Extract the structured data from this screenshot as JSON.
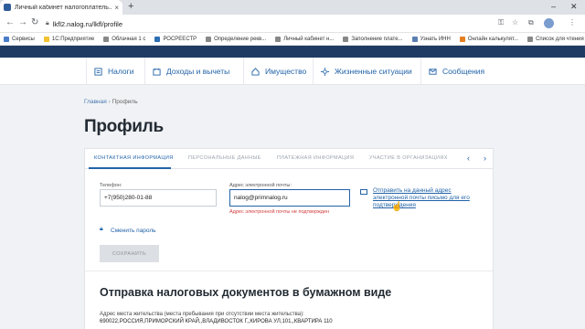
{
  "browser": {
    "tab_title": "Личный кабинет налогоплатель...",
    "tab_close": "×",
    "new_tab": "+",
    "minimize": "–",
    "close": "✕",
    "url": "lkfl2.nalog.ru/lkfl/profile",
    "bookmarks": [
      {
        "label": "Сервисы",
        "color": "#4a7dc9"
      },
      {
        "label": "1С:Предприятие",
        "color": "#f2c230"
      },
      {
        "label": "Облачная 1 с",
        "color": "#888888"
      },
      {
        "label": "РОСРЕЕСТР",
        "color": "#2d6db3"
      },
      {
        "label": "Определение рекв...",
        "color": "#888888"
      },
      {
        "label": "Личный кабинет н...",
        "color": "#888888"
      },
      {
        "label": "Заполнение плате...",
        "color": "#888888"
      },
      {
        "label": "Узнать ИНН",
        "color": "#5a7fb0"
      },
      {
        "label": "Онлайн калькулят...",
        "color": "#e67e22"
      },
      {
        "label": "Список для чтения",
        "color": "#888888"
      }
    ]
  },
  "nav": {
    "items": [
      {
        "label": "Налоги",
        "icon": "taxes-icon"
      },
      {
        "label": "Доходы и вычеты",
        "icon": "income-icon"
      },
      {
        "label": "Имущество",
        "icon": "property-icon"
      },
      {
        "label": "Жизненные ситуации",
        "icon": "life-situations-icon"
      },
      {
        "label": "Сообщения",
        "icon": "messages-icon"
      }
    ]
  },
  "breadcrumb": {
    "home": "Главная",
    "sep": "›",
    "current": "Профиль"
  },
  "page_title": "Профиль",
  "profile_tabs": [
    {
      "label": "Контактная информация",
      "active": true
    },
    {
      "label": "Персональные данные",
      "active": false
    },
    {
      "label": "Платежная информация",
      "active": false
    },
    {
      "label": "Участие в организациях",
      "active": false
    }
  ],
  "tab_prev": "‹",
  "tab_next": "›",
  "contact": {
    "phone_label": "Телефон:",
    "phone_value": "+7(950)280-01-88",
    "email_label": "Адрес электронной почты:",
    "email_value": "nalog@primnalog.ru",
    "email_error": "Адрес электронной почты не подтвержден",
    "resend_link": "Отправить на данный адрес электронной почты письмо для его подтверждения",
    "change_password": "Сменить пароль",
    "save_button": "Сохранить"
  },
  "paper_docs": {
    "title": "Отправка налоговых документов в бумажном виде",
    "address_label": "Адрес места жительства (места пребывания при отсутствии места жительства):",
    "address_value": "690022,РОССИЯ,ПРИМОРСКИЙ КРАЙ,,ВЛАДИВОСТОК Г,,КИРОВА УЛ,101,,КВАРТИРА 110"
  },
  "colors": {
    "accent": "#2263a8",
    "header_bar": "#1f3b63",
    "error": "#d23b3b"
  }
}
